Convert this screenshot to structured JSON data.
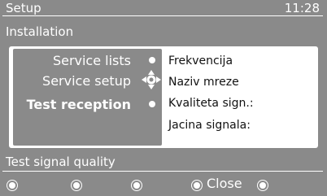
{
  "header": {
    "title": "Setup",
    "clock": "11:28",
    "subtitle": "Installation"
  },
  "menu": {
    "items": [
      {
        "label": "Service lists",
        "active": false
      },
      {
        "label": "Service setup",
        "active": false
      },
      {
        "label": "Test reception",
        "active": true
      }
    ]
  },
  "info_panel": {
    "fields": [
      "Frekvencija",
      "Naziv mreze",
      "Kvaliteta sign.:",
      "Jacina signala:"
    ]
  },
  "footer": {
    "help_text": "Test signal quality",
    "close_label": "Close"
  },
  "icons": {
    "navigation": "dpad-navigation-icon",
    "bullet": "bullet-icon",
    "color_key": "remote-key-icon"
  },
  "colors": {
    "background": "#8a8a8a",
    "panel": "#ffffff",
    "text_light": "#ffffff",
    "text_dark": "#111111"
  }
}
